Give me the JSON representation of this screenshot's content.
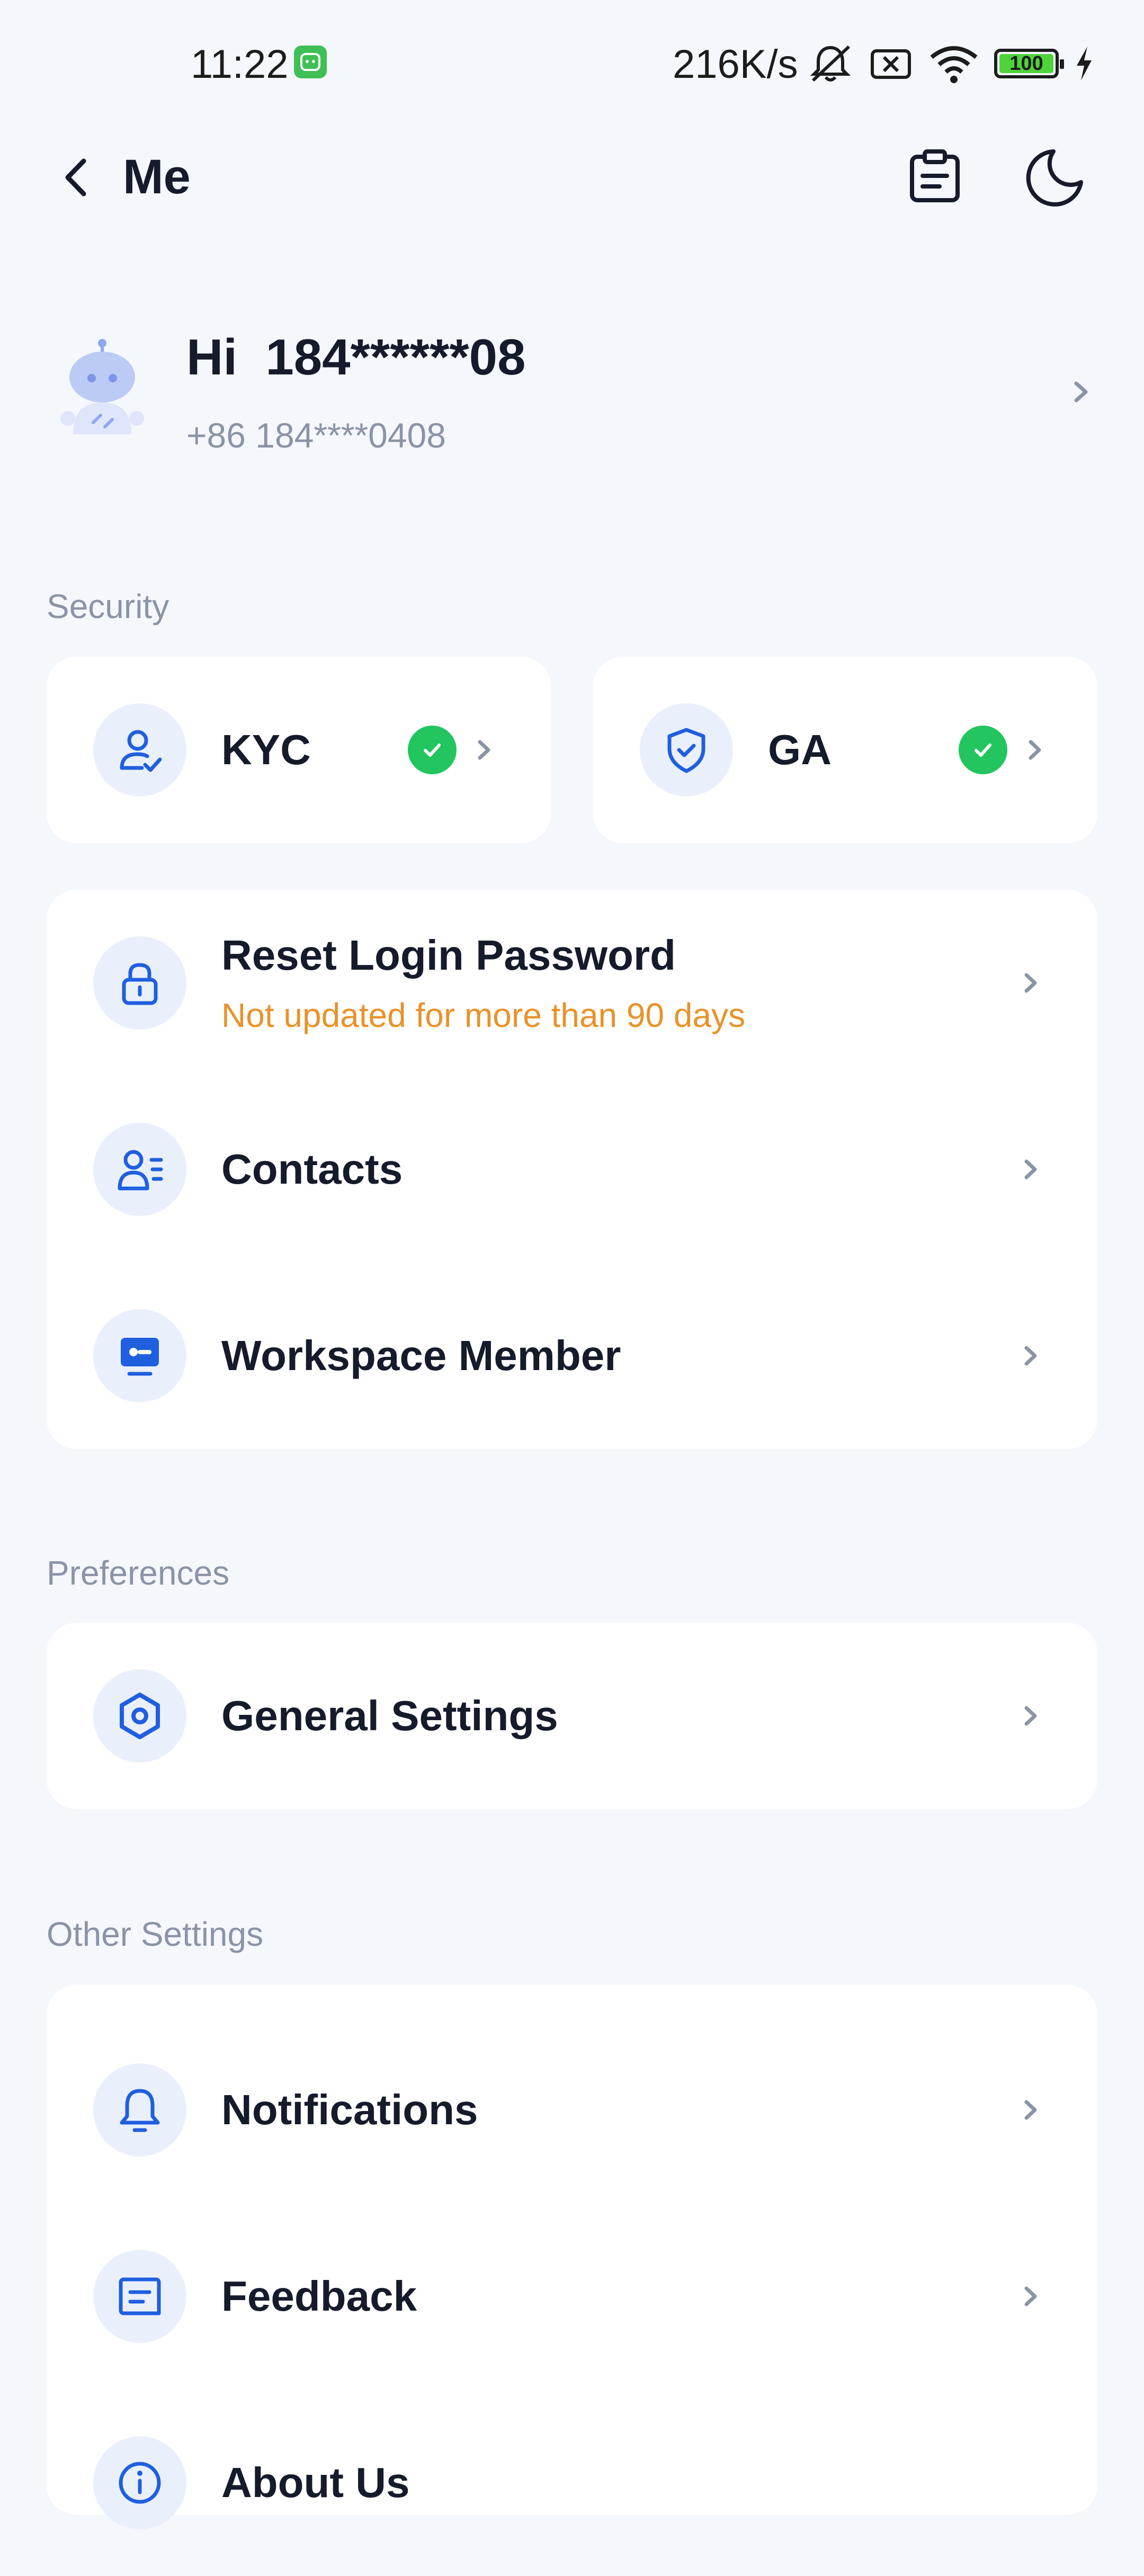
{
  "status_bar": {
    "time": "11:22",
    "speed": "216K/s",
    "battery": "100"
  },
  "header": {
    "title": "Me"
  },
  "profile": {
    "greeting": "Hi  184******08",
    "phone": "+86 184****0408"
  },
  "sections": {
    "security": "Security",
    "preferences": "Preferences",
    "other": "Other Settings"
  },
  "security": {
    "kyc_label": "KYC",
    "ga_label": "GA"
  },
  "account_rows": {
    "reset_password": "Reset Login Password",
    "reset_password_note": "Not updated for more than 90 days",
    "contacts": "Contacts",
    "workspace_member": "Workspace Member"
  },
  "preferences_rows": {
    "general_settings": "General Settings"
  },
  "other_rows": {
    "notifications": "Notifications",
    "feedback": "Feedback",
    "about_us": "About Us"
  },
  "colors": {
    "accent": "#1f5fe0",
    "success": "#22c55e",
    "warning": "#e9922a",
    "background": "#f4f7fc"
  }
}
